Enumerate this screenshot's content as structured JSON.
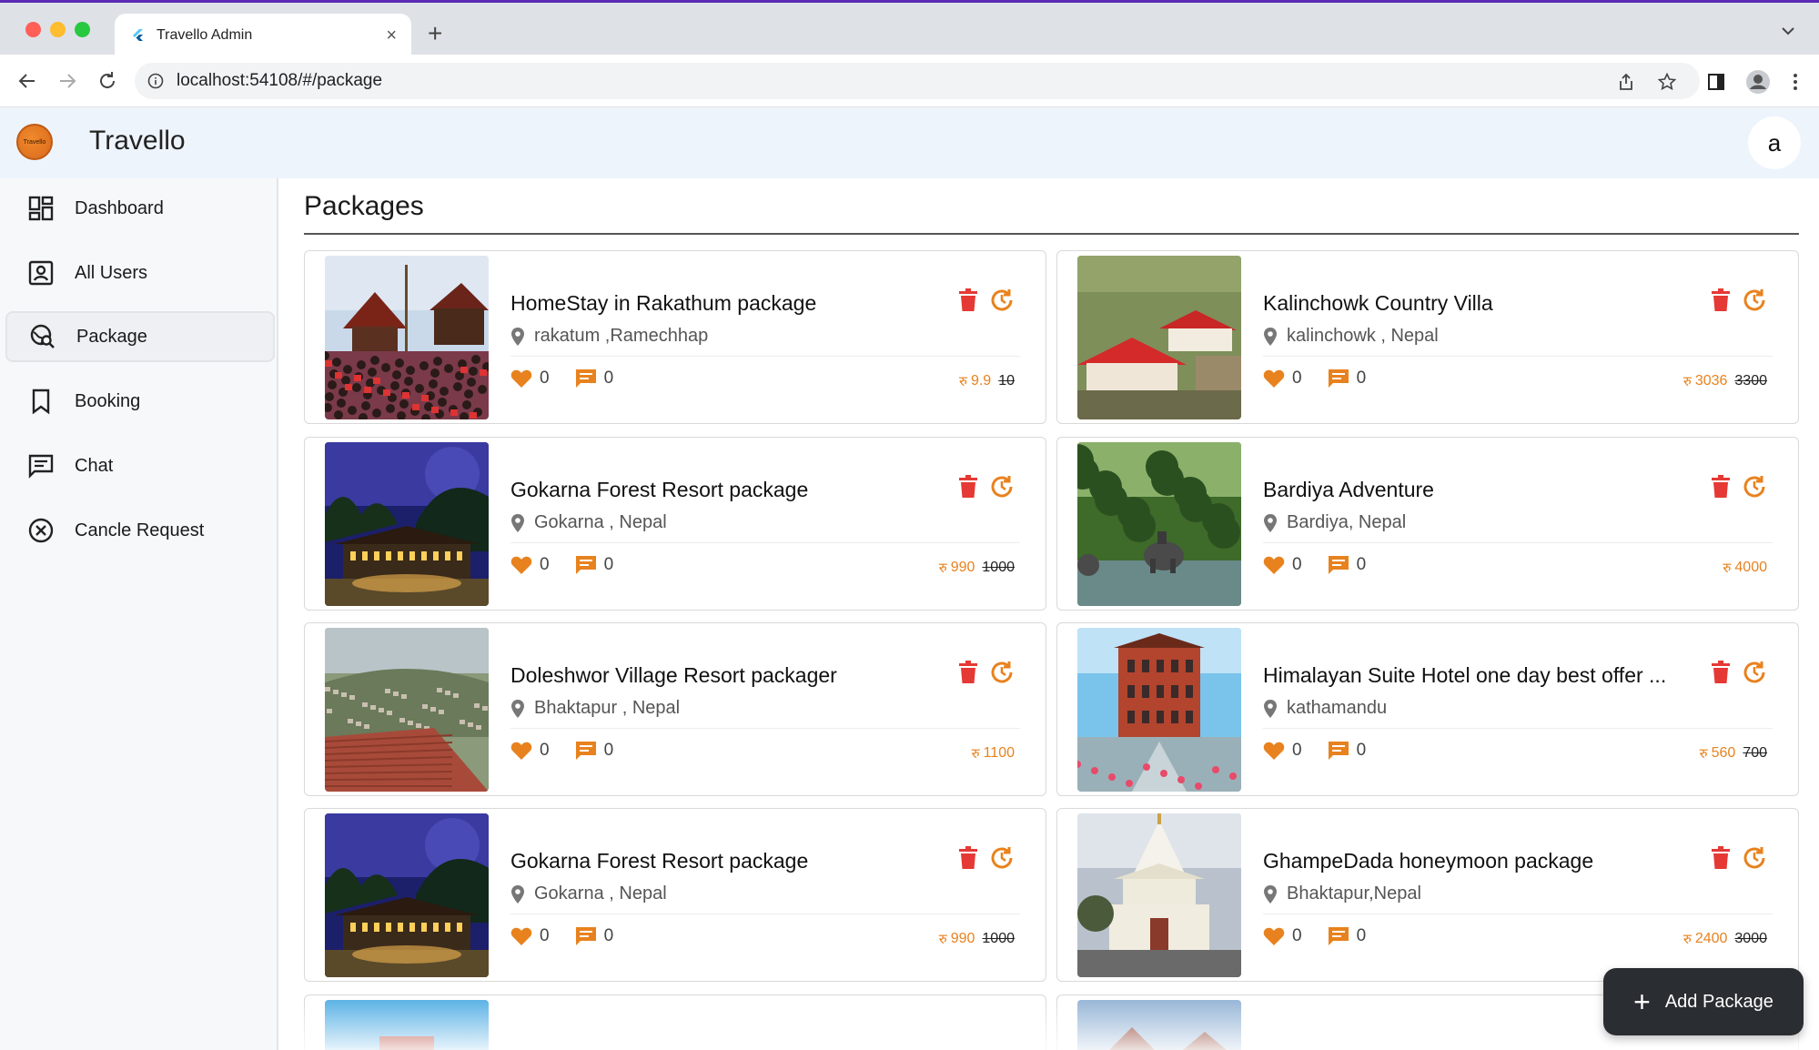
{
  "browser": {
    "tab_title": "Travello Admin",
    "url": "localhost:54108/#/package"
  },
  "app": {
    "title": "Travello",
    "logo_text": "Travello",
    "avatar_letter": "a"
  },
  "sidebar": {
    "items": [
      {
        "label": "Dashboard",
        "icon": "dashboard-icon"
      },
      {
        "label": "All Users",
        "icon": "account-box-icon"
      },
      {
        "label": "Package",
        "icon": "travel-explore-icon",
        "active": true
      },
      {
        "label": "Booking",
        "icon": "bookmark-icon"
      },
      {
        "label": "Chat",
        "icon": "chat-icon"
      },
      {
        "label": "Cancle Request",
        "icon": "cancel-circle-icon"
      }
    ]
  },
  "main": {
    "title": "Packages",
    "currency_symbol": "रु",
    "packages": [
      {
        "title": "HomeStay in Rakathum package",
        "location": "rakatum ,Ramechhap",
        "likes": "0",
        "comments": "0",
        "price": "9.9",
        "old_price": "10",
        "image": "crowd-temple"
      },
      {
        "title": "Kalinchowk Country Villa",
        "location": "kalinchowk , Nepal",
        "likes": "0",
        "comments": "0",
        "price": "3036",
        "old_price": "3300",
        "image": "red-roof-village"
      },
      {
        "title": "Gokarna Forest Resort package",
        "location": "Gokarna , Nepal",
        "likes": "0",
        "comments": "0",
        "price": "990",
        "old_price": "1000",
        "image": "night-resort"
      },
      {
        "title": "Bardiya Adventure",
        "location": "Bardiya, Nepal",
        "likes": "0",
        "comments": "0",
        "price": "4000",
        "old_price": "",
        "image": "jungle-elephant"
      },
      {
        "title": "Doleshwor Village Resort packager",
        "location": "Bhaktapur , Nepal",
        "likes": "0",
        "comments": "0",
        "price": "1100",
        "old_price": "",
        "image": "hill-village"
      },
      {
        "title": "Himalayan Suite Hotel one day best offer ...",
        "location": "kathamandu",
        "likes": "0",
        "comments": "0",
        "price": "560",
        "old_price": "700",
        "image": "brick-hotel"
      },
      {
        "title": "Gokarna Forest Resort package",
        "location": "Gokarna , Nepal",
        "likes": "0",
        "comments": "0",
        "price": "990",
        "old_price": "1000",
        "image": "night-resort"
      },
      {
        "title": "GhampeDada honeymoon package",
        "location": "Bhaktapur,Nepal",
        "likes": "0",
        "comments": "0",
        "price": "2400",
        "old_price": "3000",
        "image": "white-temple"
      }
    ]
  },
  "fab": {
    "label": "Add Package"
  },
  "colors": {
    "accent": "#e8821e",
    "delete": "#e53935",
    "header_bg": "#eef4fc",
    "sidebar_bg": "#f7f8fa"
  }
}
